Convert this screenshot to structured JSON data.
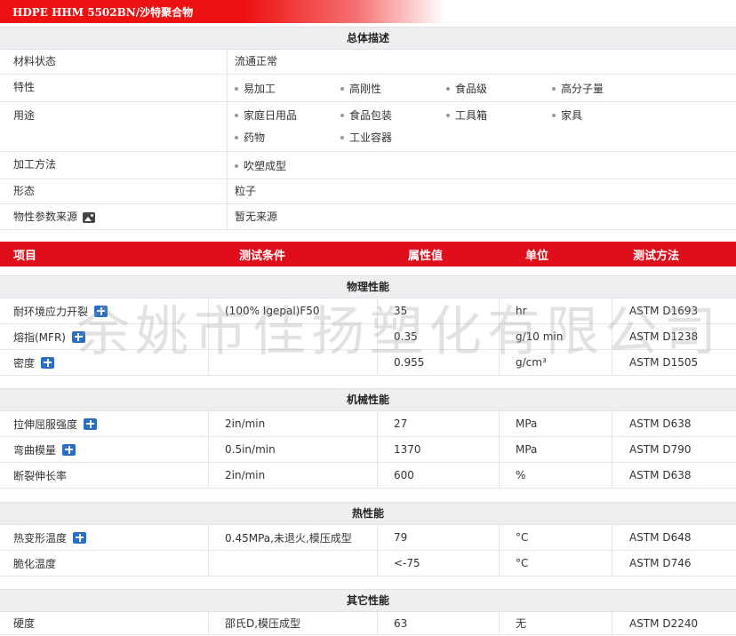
{
  "title": "HDPE HHM 5502BN/沙特聚合物",
  "overview": {
    "heading": "总体描述",
    "material_status": {
      "label": "材料状态",
      "value": "流通正常"
    },
    "features": {
      "label": "特性",
      "items": [
        "易加工",
        "高刚性",
        "食品级",
        "高分子量"
      ]
    },
    "uses": {
      "label": "用途",
      "items": [
        "家庭日用品",
        "食品包装",
        "工具箱",
        "家具",
        "药物",
        "工业容器"
      ]
    },
    "processing": {
      "label": "加工方法",
      "items": [
        "吹塑成型"
      ]
    },
    "form": {
      "label": "形态",
      "value": "粒子"
    },
    "source": {
      "label": "物性参数来源",
      "value": "暂无来源"
    }
  },
  "columns": {
    "item": "项目",
    "condition": "测试条件",
    "value": "属性值",
    "unit": "单位",
    "method": "测试方法"
  },
  "sections": {
    "physical": {
      "heading": "物理性能",
      "rows": [
        {
          "name": "耐环境应力开裂",
          "condition": "(100% Igepal)F50",
          "value": "35",
          "unit": "hr",
          "method": "ASTM D1693"
        },
        {
          "name": "熔指(MFR)",
          "condition": "",
          "value": "0.35",
          "unit": "g/10 min",
          "method": "ASTM D1238"
        },
        {
          "name": "密度",
          "condition": "",
          "value": "0.955",
          "unit": "g/cm³",
          "method": "ASTM D1505"
        }
      ]
    },
    "mechanical": {
      "heading": "机械性能",
      "rows": [
        {
          "name": "拉伸屈服强度",
          "condition": "2in/min",
          "value": "27",
          "unit": "MPa",
          "method": "ASTM D638"
        },
        {
          "name": "弯曲模量",
          "condition": "0.5in/min",
          "value": "1370",
          "unit": "MPa",
          "method": "ASTM D790"
        },
        {
          "name": "断裂伸长率",
          "condition": "2in/min",
          "value": "600",
          "unit": "%",
          "method": "ASTM D638"
        }
      ]
    },
    "thermal": {
      "heading": "热性能",
      "rows": [
        {
          "name": "热变形温度",
          "condition": "0.45MPa,未退火,模压成型",
          "value": "79",
          "unit": "°C",
          "method": "ASTM D648"
        },
        {
          "name": "脆化温度",
          "condition": "",
          "value": "<-75",
          "unit": "°C",
          "method": "ASTM D746"
        }
      ]
    },
    "other": {
      "heading": "其它性能",
      "rows": [
        {
          "name": "硬度",
          "condition": "邵氏D,模压成型",
          "value": "63",
          "unit": "无",
          "method": "ASTM D2240"
        }
      ]
    }
  },
  "watermark": "余姚市佳扬塑化有限公司"
}
